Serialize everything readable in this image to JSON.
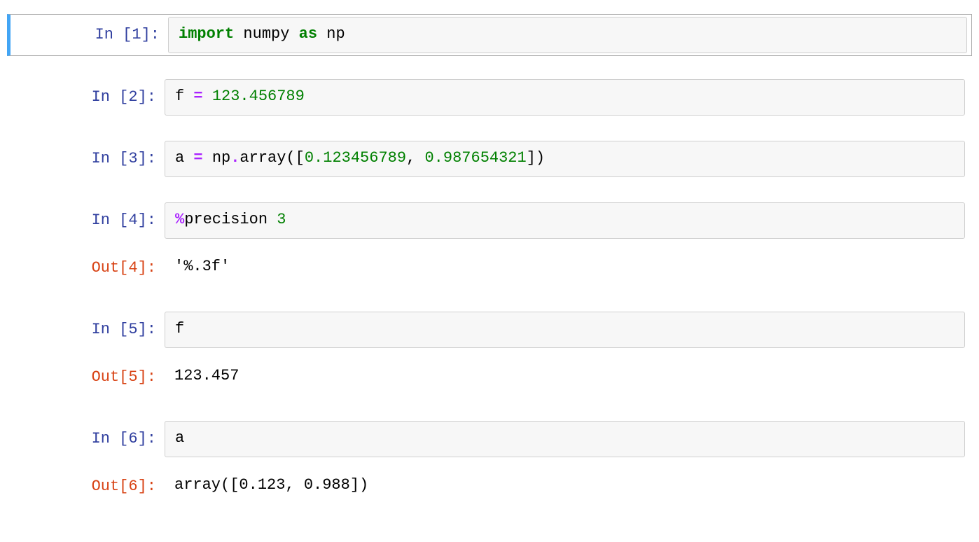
{
  "cells": [
    {
      "selected": true,
      "in_prompt": "In [1]:",
      "tokens": [
        {
          "t": "import",
          "c": "tk-keyword"
        },
        {
          "t": " ",
          "c": ""
        },
        {
          "t": "numpy",
          "c": "tk-name"
        },
        {
          "t": " ",
          "c": ""
        },
        {
          "t": "as",
          "c": "tk-keyword"
        },
        {
          "t": " ",
          "c": ""
        },
        {
          "t": "np",
          "c": "tk-name"
        }
      ],
      "has_output": false
    },
    {
      "selected": false,
      "in_prompt": "In [2]:",
      "tokens": [
        {
          "t": "f",
          "c": "tk-name"
        },
        {
          "t": " ",
          "c": ""
        },
        {
          "t": "=",
          "c": "tk-op"
        },
        {
          "t": " ",
          "c": ""
        },
        {
          "t": "123.456789",
          "c": "tk-num"
        }
      ],
      "has_output": false
    },
    {
      "selected": false,
      "in_prompt": "In [3]:",
      "tokens": [
        {
          "t": "a",
          "c": "tk-name"
        },
        {
          "t": " ",
          "c": ""
        },
        {
          "t": "=",
          "c": "tk-op"
        },
        {
          "t": " ",
          "c": ""
        },
        {
          "t": "np",
          "c": "tk-name"
        },
        {
          "t": ".",
          "c": "tk-op"
        },
        {
          "t": "array([",
          "c": "tk-name"
        },
        {
          "t": "0.123456789",
          "c": "tk-num"
        },
        {
          "t": ", ",
          "c": "tk-name"
        },
        {
          "t": "0.987654321",
          "c": "tk-num"
        },
        {
          "t": "])",
          "c": "tk-name"
        }
      ],
      "has_output": false
    },
    {
      "selected": false,
      "in_prompt": "In [4]:",
      "tokens": [
        {
          "t": "%",
          "c": "tk-magic"
        },
        {
          "t": "precision ",
          "c": "tk-name"
        },
        {
          "t": "3",
          "c": "tk-num"
        }
      ],
      "has_output": true,
      "out_prompt": "Out[4]:",
      "output": "'%.3f'"
    },
    {
      "selected": false,
      "in_prompt": "In [5]:",
      "tokens": [
        {
          "t": "f",
          "c": "tk-name"
        }
      ],
      "has_output": true,
      "out_prompt": "Out[5]:",
      "output": "123.457"
    },
    {
      "selected": false,
      "in_prompt": "In [6]:",
      "tokens": [
        {
          "t": "a",
          "c": "tk-name"
        }
      ],
      "has_output": true,
      "out_prompt": "Out[6]:",
      "output": "array([0.123, 0.988])"
    }
  ]
}
